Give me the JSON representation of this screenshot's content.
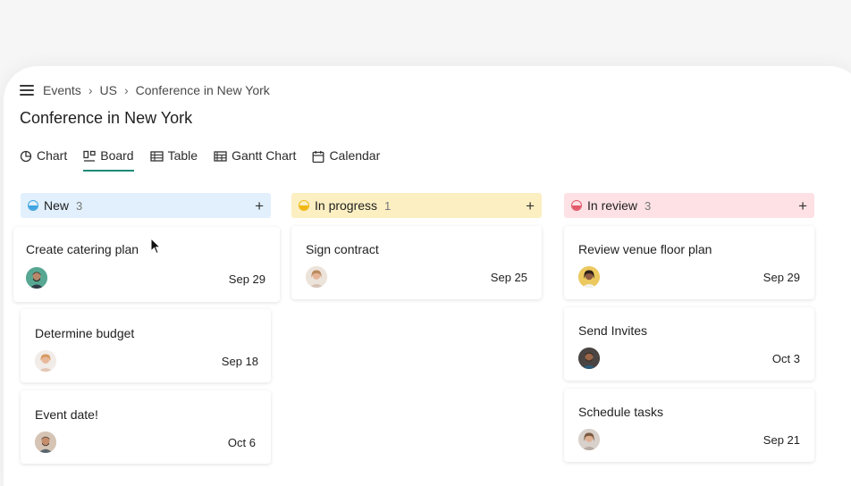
{
  "breadcrumb": [
    "Events",
    "US",
    "Conference in New York"
  ],
  "page_title": "Conference in New York",
  "tabs": [
    {
      "label": "Chart",
      "icon": "pie-chart-icon"
    },
    {
      "label": "Board",
      "icon": "board-icon",
      "active": true
    },
    {
      "label": "Table",
      "icon": "table-icon"
    },
    {
      "label": "Gantt Chart",
      "icon": "gantt-icon"
    },
    {
      "label": "Calendar",
      "icon": "calendar-icon"
    }
  ],
  "columns": [
    {
      "title": "New",
      "count": "3",
      "color": "#3fa4e0",
      "bg": "#e1f0fc",
      "cards": [
        {
          "title": "Create catering plan",
          "date": "Sep 29"
        },
        {
          "title": "Determine budget",
          "date": "Sep 18"
        },
        {
          "title": "Event date!",
          "date": "Oct 6"
        }
      ]
    },
    {
      "title": "In progress",
      "count": "1",
      "color": "#f0b712",
      "bg": "#fcefc2",
      "cards": [
        {
          "title": "Sign contract",
          "date": "Sep 25"
        }
      ]
    },
    {
      "title": "In review",
      "count": "3",
      "color": "#e2596a",
      "bg": "#fde1e4",
      "cards": [
        {
          "title": "Review venue floor plan",
          "date": "Sep 29"
        },
        {
          "title": "Send Invites",
          "date": "Oct 3"
        },
        {
          "title": "Schedule tasks",
          "date": "Sep 21"
        }
      ]
    }
  ],
  "add_symbol": "+",
  "breadcrumb_separator": "›"
}
